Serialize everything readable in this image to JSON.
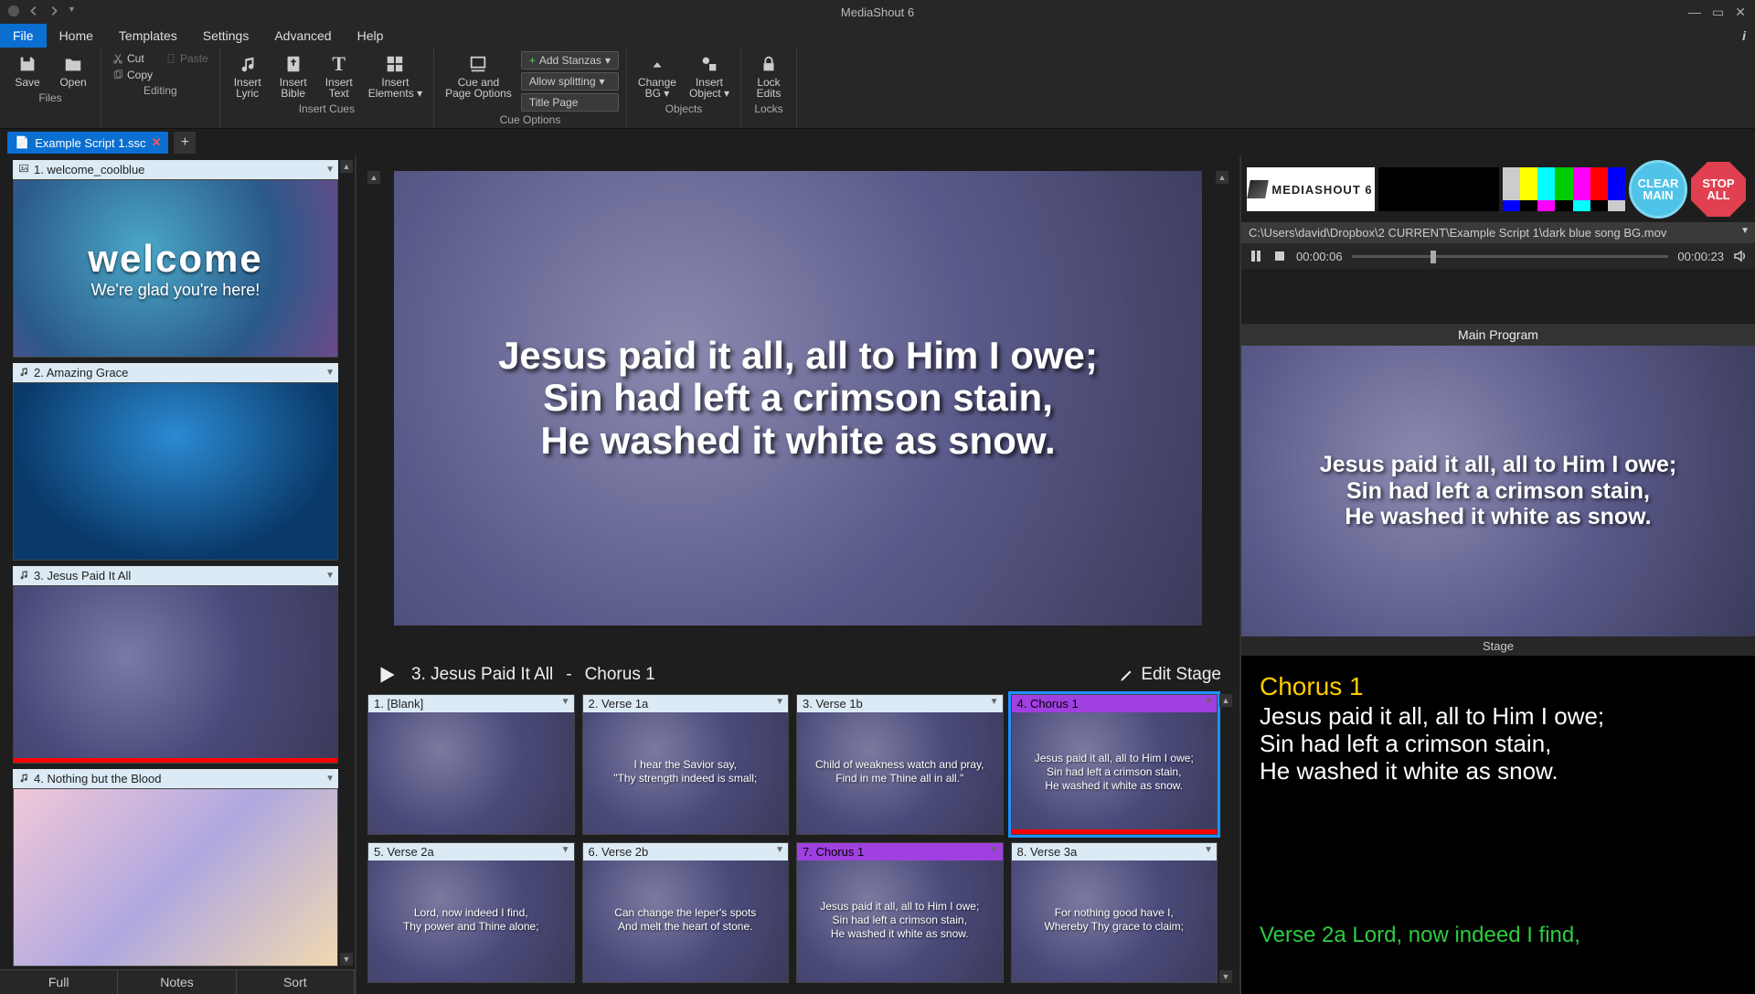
{
  "titlebar": {
    "title": "MediaShout 6"
  },
  "menubar": {
    "items": [
      "File",
      "Home",
      "Templates",
      "Settings",
      "Advanced",
      "Help"
    ]
  },
  "ribbon": {
    "save": "Save",
    "open": "Open",
    "cut": "Cut",
    "copy": "Copy",
    "paste": "Paste",
    "insert_lyric": "Insert\nLyric",
    "insert_bible": "Insert\nBible",
    "insert_text": "Insert\nText",
    "insert_elements": "Insert\nElements",
    "cue_page": "Cue and\nPage Options",
    "add_stanzas": "Add Stanzas",
    "allow_splitting": "Allow splitting",
    "title_page": "Title Page",
    "change_bg": "Change\nBG",
    "insert_object": "Insert\nObject",
    "lock_edits": "Lock\nEdits",
    "groups": {
      "files": "Files",
      "editing": "Editing",
      "insert_cues": "Insert Cues",
      "cue_options": "Cue Options",
      "objects": "Objects",
      "locks": "Locks"
    }
  },
  "tabs": {
    "script": "Example Script 1.ssc"
  },
  "cues": [
    {
      "title": "1. welcome_coolblue",
      "icon": "image",
      "bg": "bg-blue1",
      "line1": "welcome",
      "line2": "We're glad you're here!"
    },
    {
      "title": "2. Amazing Grace",
      "icon": "music",
      "bg": "bg-blue2"
    },
    {
      "title": "3. Jesus Paid It All",
      "icon": "music",
      "bg": "bg-purple",
      "active": true
    },
    {
      "title": "4. Nothing but the Blood",
      "icon": "music",
      "bg": "bg-pink"
    }
  ],
  "leftfooter": [
    "Full",
    "Notes",
    "Sort"
  ],
  "preview": {
    "line1": "Jesus paid it all, all to Him I owe;",
    "line2": "Sin had left a crimson stain,",
    "line3": "He washed it white as snow."
  },
  "subhead": {
    "title": "3. Jesus Paid It All",
    "sep": "  -  ",
    "part": "Chorus 1",
    "edit": "Edit Stage"
  },
  "slides": [
    {
      "label": "1. [Blank]",
      "text": ""
    },
    {
      "label": "2. Verse 1a",
      "text": "I hear the Savior say,\n\"Thy strength indeed is small;"
    },
    {
      "label": "3. Verse 1b",
      "text": "Child of weakness watch and pray,\nFind in me Thine all in all.\""
    },
    {
      "label": "4. Chorus 1",
      "text": "Jesus paid it all, all to Him I owe;\nSin had left a crimson stain,\nHe washed it white as snow.",
      "purple": true,
      "selected": true
    },
    {
      "label": "5. Verse 2a",
      "text": "Lord, now indeed I find,\nThy power and Thine alone;"
    },
    {
      "label": "6. Verse 2b",
      "text": "Can change the leper's spots\nAnd melt the heart of stone."
    },
    {
      "label": "7. Chorus 1",
      "text": "Jesus paid it all, all to Him I owe;\nSin had left a crimson stain,\nHe washed it white as snow.",
      "purple": true
    },
    {
      "label": "8. Verse 3a",
      "text": "For nothing good have I,\nWhereby Thy grace to claim;"
    }
  ],
  "right": {
    "logo": "MEDIASHOUT 6",
    "clear": "CLEAR\nMAIN",
    "stop": "STOP\nALL",
    "path": "C:\\Users\\david\\Dropbox\\2 CURRENT\\Example Script 1\\dark blue song BG.mov",
    "cur_time": "00:00:06",
    "total_time": "00:00:23",
    "program_head": "Main Program",
    "prog_l1": "Jesus paid it all, all to Him I owe;",
    "prog_l2": "Sin had left a crimson stain,",
    "prog_l3": "He washed it white as snow.",
    "stage_head": "Stage",
    "stage_title": "Chorus 1",
    "stage_body": "Jesus paid it all, all to Him I owe;\nSin had left a crimson stain,\nHe washed it white as snow.",
    "stage_next": "Verse 2a Lord, now indeed I find,"
  }
}
